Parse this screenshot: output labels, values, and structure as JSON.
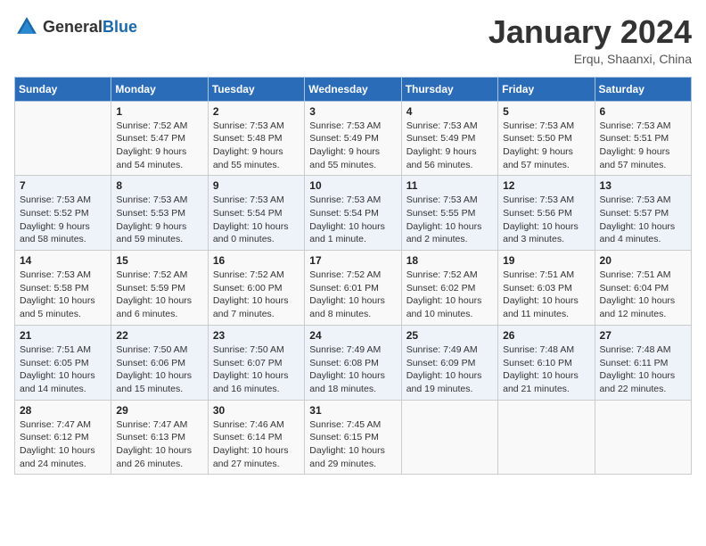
{
  "header": {
    "logo": {
      "general": "General",
      "blue": "Blue"
    },
    "title": "January 2024",
    "location": "Erqu, Shaanxi, China"
  },
  "columns": [
    "Sunday",
    "Monday",
    "Tuesday",
    "Wednesday",
    "Thursday",
    "Friday",
    "Saturday"
  ],
  "weeks": [
    [
      {
        "day": "",
        "info": ""
      },
      {
        "day": "1",
        "info": "Sunrise: 7:52 AM\nSunset: 5:47 PM\nDaylight: 9 hours\nand 54 minutes."
      },
      {
        "day": "2",
        "info": "Sunrise: 7:53 AM\nSunset: 5:48 PM\nDaylight: 9 hours\nand 55 minutes."
      },
      {
        "day": "3",
        "info": "Sunrise: 7:53 AM\nSunset: 5:49 PM\nDaylight: 9 hours\nand 55 minutes."
      },
      {
        "day": "4",
        "info": "Sunrise: 7:53 AM\nSunset: 5:49 PM\nDaylight: 9 hours\nand 56 minutes."
      },
      {
        "day": "5",
        "info": "Sunrise: 7:53 AM\nSunset: 5:50 PM\nDaylight: 9 hours\nand 57 minutes."
      },
      {
        "day": "6",
        "info": "Sunrise: 7:53 AM\nSunset: 5:51 PM\nDaylight: 9 hours\nand 57 minutes."
      }
    ],
    [
      {
        "day": "7",
        "info": "Sunrise: 7:53 AM\nSunset: 5:52 PM\nDaylight: 9 hours\nand 58 minutes."
      },
      {
        "day": "8",
        "info": "Sunrise: 7:53 AM\nSunset: 5:53 PM\nDaylight: 9 hours\nand 59 minutes."
      },
      {
        "day": "9",
        "info": "Sunrise: 7:53 AM\nSunset: 5:54 PM\nDaylight: 10 hours\nand 0 minutes."
      },
      {
        "day": "10",
        "info": "Sunrise: 7:53 AM\nSunset: 5:54 PM\nDaylight: 10 hours\nand 1 minute."
      },
      {
        "day": "11",
        "info": "Sunrise: 7:53 AM\nSunset: 5:55 PM\nDaylight: 10 hours\nand 2 minutes."
      },
      {
        "day": "12",
        "info": "Sunrise: 7:53 AM\nSunset: 5:56 PM\nDaylight: 10 hours\nand 3 minutes."
      },
      {
        "day": "13",
        "info": "Sunrise: 7:53 AM\nSunset: 5:57 PM\nDaylight: 10 hours\nand 4 minutes."
      }
    ],
    [
      {
        "day": "14",
        "info": "Sunrise: 7:53 AM\nSunset: 5:58 PM\nDaylight: 10 hours\nand 5 minutes."
      },
      {
        "day": "15",
        "info": "Sunrise: 7:52 AM\nSunset: 5:59 PM\nDaylight: 10 hours\nand 6 minutes."
      },
      {
        "day": "16",
        "info": "Sunrise: 7:52 AM\nSunset: 6:00 PM\nDaylight: 10 hours\nand 7 minutes."
      },
      {
        "day": "17",
        "info": "Sunrise: 7:52 AM\nSunset: 6:01 PM\nDaylight: 10 hours\nand 8 minutes."
      },
      {
        "day": "18",
        "info": "Sunrise: 7:52 AM\nSunset: 6:02 PM\nDaylight: 10 hours\nand 10 minutes."
      },
      {
        "day": "19",
        "info": "Sunrise: 7:51 AM\nSunset: 6:03 PM\nDaylight: 10 hours\nand 11 minutes."
      },
      {
        "day": "20",
        "info": "Sunrise: 7:51 AM\nSunset: 6:04 PM\nDaylight: 10 hours\nand 12 minutes."
      }
    ],
    [
      {
        "day": "21",
        "info": "Sunrise: 7:51 AM\nSunset: 6:05 PM\nDaylight: 10 hours\nand 14 minutes."
      },
      {
        "day": "22",
        "info": "Sunrise: 7:50 AM\nSunset: 6:06 PM\nDaylight: 10 hours\nand 15 minutes."
      },
      {
        "day": "23",
        "info": "Sunrise: 7:50 AM\nSunset: 6:07 PM\nDaylight: 10 hours\nand 16 minutes."
      },
      {
        "day": "24",
        "info": "Sunrise: 7:49 AM\nSunset: 6:08 PM\nDaylight: 10 hours\nand 18 minutes."
      },
      {
        "day": "25",
        "info": "Sunrise: 7:49 AM\nSunset: 6:09 PM\nDaylight: 10 hours\nand 19 minutes."
      },
      {
        "day": "26",
        "info": "Sunrise: 7:48 AM\nSunset: 6:10 PM\nDaylight: 10 hours\nand 21 minutes."
      },
      {
        "day": "27",
        "info": "Sunrise: 7:48 AM\nSunset: 6:11 PM\nDaylight: 10 hours\nand 22 minutes."
      }
    ],
    [
      {
        "day": "28",
        "info": "Sunrise: 7:47 AM\nSunset: 6:12 PM\nDaylight: 10 hours\nand 24 minutes."
      },
      {
        "day": "29",
        "info": "Sunrise: 7:47 AM\nSunset: 6:13 PM\nDaylight: 10 hours\nand 26 minutes."
      },
      {
        "day": "30",
        "info": "Sunrise: 7:46 AM\nSunset: 6:14 PM\nDaylight: 10 hours\nand 27 minutes."
      },
      {
        "day": "31",
        "info": "Sunrise: 7:45 AM\nSunset: 6:15 PM\nDaylight: 10 hours\nand 29 minutes."
      },
      {
        "day": "",
        "info": ""
      },
      {
        "day": "",
        "info": ""
      },
      {
        "day": "",
        "info": ""
      }
    ]
  ]
}
